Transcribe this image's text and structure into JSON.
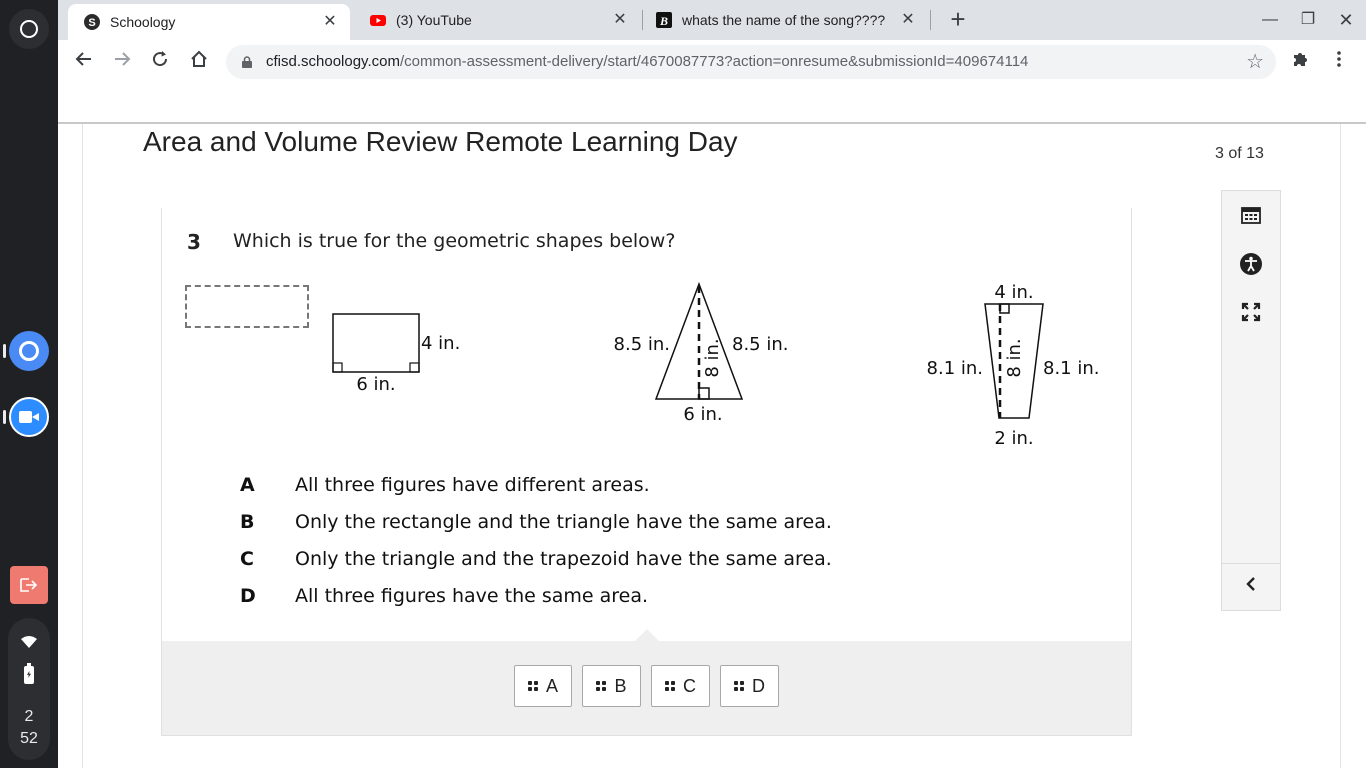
{
  "shelf": {
    "launcher_icon": "launcher-icon",
    "apps": [
      {
        "name": "Chrome",
        "icon": "chrome-icon"
      },
      {
        "name": "Zoom",
        "icon": "zoom-icon"
      },
      {
        "name": "Exit",
        "icon": "exit-icon"
      }
    ],
    "clock": {
      "hour": "2",
      "minute": "52"
    },
    "accent_colors": {
      "chrome": "#4a8af4",
      "zoom": "#2d8cff",
      "exit": "#ee7a70"
    }
  },
  "browser": {
    "tabs": [
      {
        "title": "Schoology",
        "icon": "schoology-icon",
        "active": true
      },
      {
        "title": "(3) YouTube",
        "icon": "youtube-icon",
        "active": false
      },
      {
        "title": "whats the name of the song????",
        "icon": "brainly-icon",
        "active": false
      }
    ],
    "address": {
      "host": "cfisd.schoology.com",
      "path": "/common-assessment-delivery/start/4670087773?action=onresume&submissionId=409674114"
    }
  },
  "assessment": {
    "title": "Area and Volume Review Remote Learning Day",
    "progress": "3 of 13",
    "question": {
      "number": "3",
      "text": "Which is true for the geometric shapes below?"
    },
    "figures": {
      "rectangle": {
        "height_label": "4 in.",
        "base_label": "6 in."
      },
      "triangle": {
        "left_side": "8.5 in.",
        "right_side": "8.5 in.",
        "height": "8 in.",
        "base": "6 in."
      },
      "trapezoid": {
        "top": "4 in.",
        "left_side": "8.1 in.",
        "right_side": "8.1 in.",
        "height": "8 in.",
        "bottom": "2 in."
      }
    },
    "choices": [
      {
        "letter": "A",
        "text": "All three figures have different areas."
      },
      {
        "letter": "B",
        "text": "Only the rectangle and the triangle have the same area."
      },
      {
        "letter": "C",
        "text": "Only the triangle and the trapezoid have the same area."
      },
      {
        "letter": "D",
        "text": "All three figures have the same area."
      }
    ],
    "drag_options": [
      "A",
      "B",
      "C",
      "D"
    ],
    "tools": [
      "calendar-icon",
      "accessibility-icon",
      "fullscreen-icon",
      "chevron-left-icon"
    ]
  }
}
